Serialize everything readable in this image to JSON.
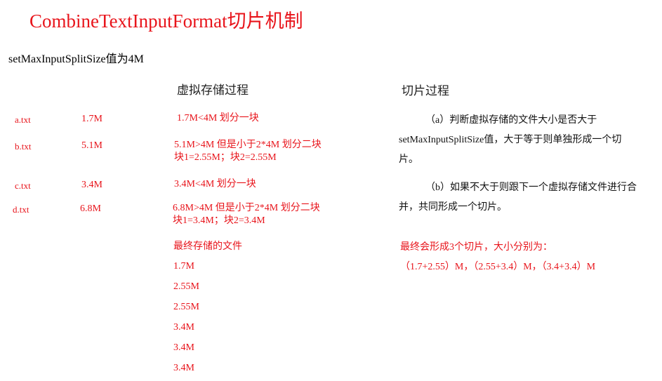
{
  "title": "CombineTextInputFormat切片机制",
  "subtitle": "setMaxInputSplitSize值为4M",
  "virtual_storage": {
    "heading": "虚拟存储过程",
    "files": [
      {
        "name": "a.txt",
        "size": "1.7M",
        "note_line1": "1.7M<4M 划分一块",
        "note_line2": ""
      },
      {
        "name": "b.txt",
        "size": "5.1M",
        "note_line1": "5.1M>4M 但是小于2*4M  划分二块",
        "note_line2": "块1=2.55M；块2=2.55M"
      },
      {
        "name": "c.txt",
        "size": "3.4M",
        "note_line1": "3.4M<4M 划分一块",
        "note_line2": ""
      },
      {
        "name": "d.txt",
        "size": "6.8M",
        "note_line1": "6.8M>4M 但是小于2*4M  划分二块",
        "note_line2": "块1=3.4M；块2=3.4M"
      }
    ],
    "final_heading": "最终存储的文件",
    "final_files": [
      "1.7M",
      "2.55M",
      "2.55M",
      "3.4M",
      "3.4M",
      "3.4M"
    ]
  },
  "split_process": {
    "heading": "切片过程",
    "para_a": "（a）判断虚拟存储的文件大小是否大于setMaxInputSplitSize值，大于等于则单独形成一个切片。",
    "para_b": "（b）如果不大于则跟下一个虚拟存储文件进行合并，共同形成一个切片。",
    "result_line1": "最终会形成3个切片，大小分别为：",
    "result_line2": "（1.7+2.55）M，（2.55+3.4）M，（3.4+3.4）M"
  },
  "colors": {
    "accent": "#e8141b",
    "text": "#000000"
  }
}
